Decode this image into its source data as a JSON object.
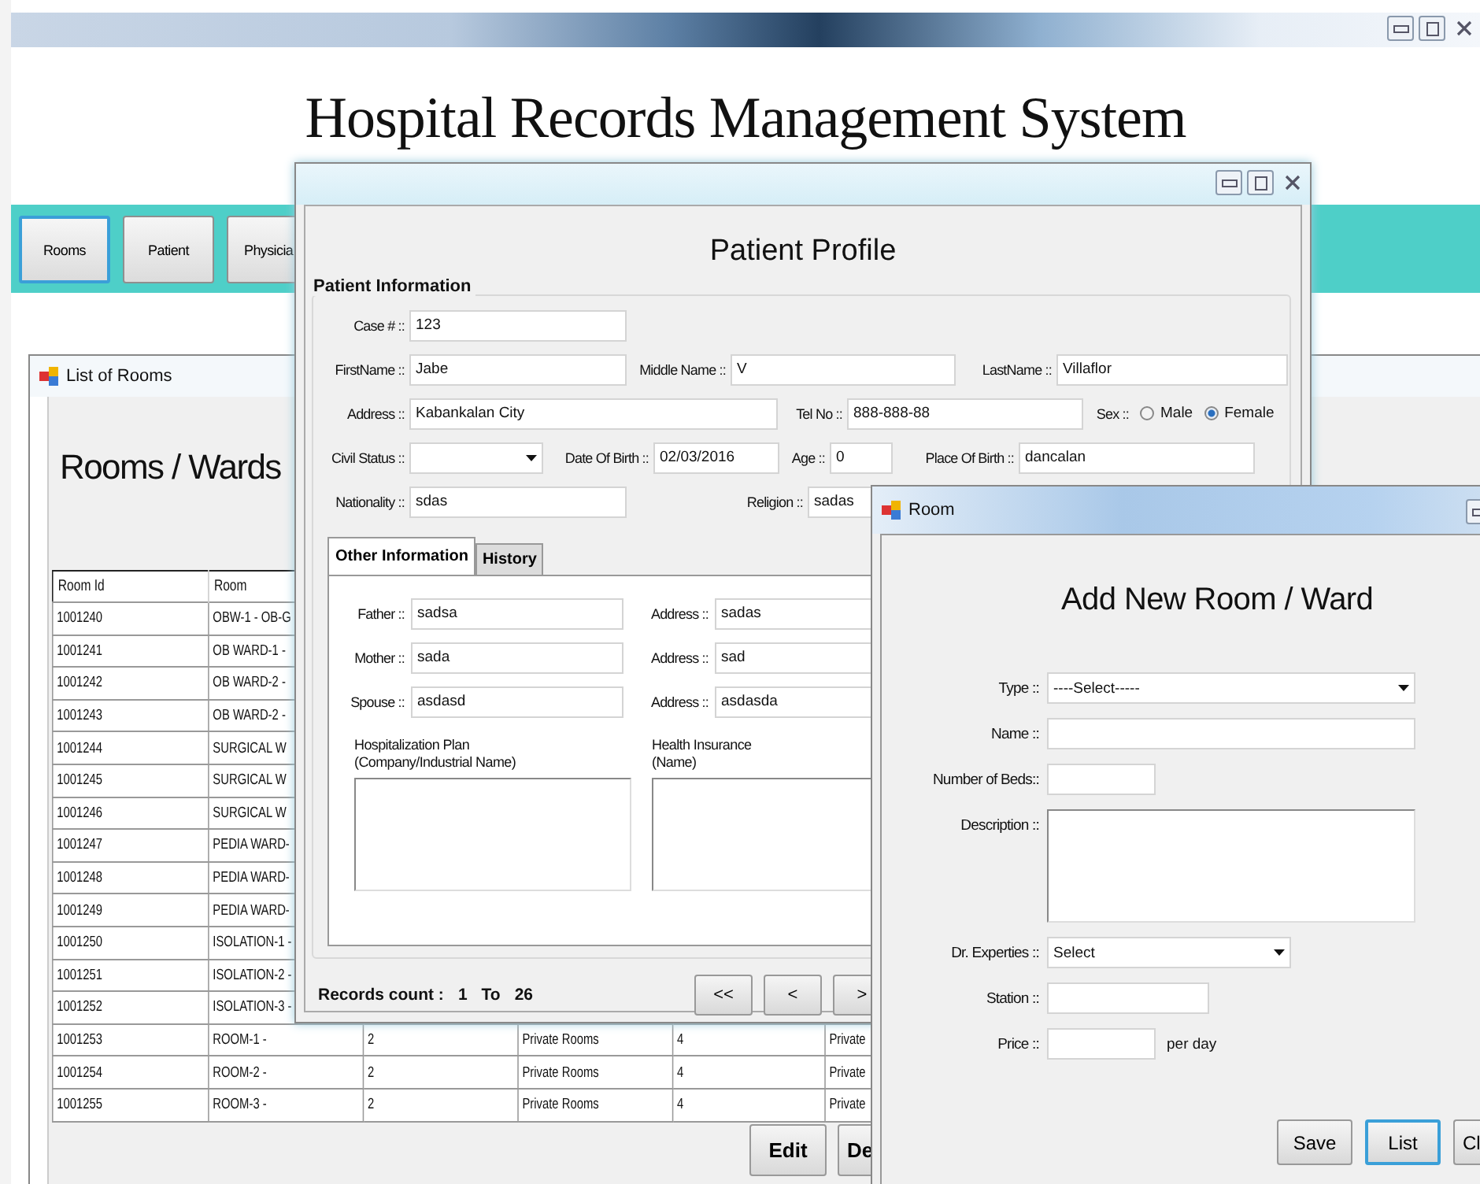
{
  "app": {
    "title": "Hospital Records Management System",
    "nav_buttons": [
      {
        "label": "Rooms",
        "selected": true
      },
      {
        "label": "Patient",
        "selected": false
      },
      {
        "label": "Physicia",
        "selected": false
      }
    ]
  },
  "rooms_window": {
    "title": "List of Rooms",
    "heading": "Rooms / Wards",
    "table": {
      "columns": [
        "Room Id",
        "Room"
      ],
      "rows": [
        [
          "1001240",
          "OBW-1 - OB-G"
        ],
        [
          "1001241",
          "OB WARD-1 -"
        ],
        [
          "1001242",
          "OB WARD-2 -"
        ],
        [
          "1001243",
          "OB WARD-2 -"
        ],
        [
          "1001244",
          "SURGICAL W"
        ],
        [
          "1001245",
          "SURGICAL W"
        ],
        [
          "1001246",
          "SURGICAL W"
        ],
        [
          "1001247",
          "PEDIA WARD-"
        ],
        [
          "1001248",
          "PEDIA WARD-"
        ],
        [
          "1001249",
          "PEDIA WARD-"
        ],
        [
          "1001250",
          "ISOLATION-1 -"
        ],
        [
          "1001251",
          "ISOLATION-2 -"
        ],
        [
          "1001252",
          "ISOLATION-3 -"
        ],
        [
          "1001253",
          "ROOM-1 -",
          "2",
          "Private Rooms",
          "4",
          "Private"
        ],
        [
          "1001254",
          "ROOM-2 -",
          "2",
          "Private Rooms",
          "4",
          "Private"
        ],
        [
          "1001255",
          "ROOM-3 -",
          "2",
          "Private Rooms",
          "4",
          "Private"
        ]
      ]
    },
    "buttons": [
      "Edit",
      "De"
    ]
  },
  "patient_window": {
    "heading": "Patient Profile",
    "group": "Patient Information",
    "fields": [
      {
        "kind": "text",
        "label": "Case # ::",
        "value": "123"
      },
      {
        "kind": "text",
        "label": "FirstName ::",
        "value": "Jabe"
      },
      {
        "kind": "text",
        "label": "Middle Name ::",
        "value": "V"
      },
      {
        "kind": "text",
        "label": "LastName ::",
        "value": "Villaflor"
      },
      {
        "kind": "text",
        "label": "Address ::",
        "value": "Kabankalan City"
      },
      {
        "kind": "text",
        "label": "Tel No ::",
        "value": "888-888-88"
      },
      {
        "kind": "radio",
        "label": "Sex ::",
        "options": [
          {
            "label": "Male",
            "selected": false
          },
          {
            "label": "Female",
            "selected": true
          }
        ]
      },
      {
        "kind": "dropdown",
        "label": "Civil Status ::"
      },
      {
        "kind": "text",
        "label": "Date Of Birth ::",
        "value": "02/03/2016"
      },
      {
        "kind": "text",
        "label": "Age ::",
        "value": "0"
      },
      {
        "kind": "text",
        "label": "Place Of Birth ::",
        "value": "dancalan"
      },
      {
        "kind": "text",
        "label": "Nationality ::",
        "value": "sdas"
      },
      {
        "kind": "text",
        "label": "Religion ::",
        "value": "sadas"
      }
    ],
    "tabs": [
      {
        "label": "Other Information",
        "selected": true
      },
      {
        "label": "History",
        "selected": false
      }
    ],
    "family": [
      {
        "label": "Father ::",
        "value": "sadsa",
        "address_label": "Address ::",
        "address": "sadas"
      },
      {
        "label": "Mother ::",
        "value": "sada",
        "address_label": "Address ::",
        "address": "sad"
      },
      {
        "label": "Spouse ::",
        "value": "asdasd",
        "address_label": "Address ::",
        "address": "asdasda"
      }
    ],
    "plans": [
      {
        "title": "Hospitalization Plan",
        "subtitle": "(Company/Industrial Name)"
      },
      {
        "title": "Health Insurance",
        "subtitle": "(Name)"
      }
    ],
    "records": {
      "label": "Records count :",
      "from": "1",
      "to_label": "To",
      "to": "26"
    },
    "pager": [
      "<<",
      "<",
      ">"
    ]
  },
  "room_window": {
    "title": "Room",
    "heading": "Add New Room / Ward",
    "fields": [
      {
        "kind": "dropdown",
        "label": "Type ::",
        "value": "----Select-----"
      },
      {
        "kind": "text",
        "label": "Name ::"
      },
      {
        "kind": "short",
        "label": "Number of Beds::"
      },
      {
        "kind": "textarea",
        "label": "Description ::"
      },
      {
        "kind": "dropdown",
        "label": "Dr. Experties ::",
        "value": "Select"
      },
      {
        "kind": "medium",
        "label": "Station ::"
      },
      {
        "kind": "short",
        "label": "Price ::",
        "suffix": "per day"
      }
    ],
    "buttons": [
      {
        "label": "Save",
        "focused": false
      },
      {
        "label": "List",
        "focused": true
      },
      {
        "label": "Cl",
        "focused": false
      }
    ]
  }
}
